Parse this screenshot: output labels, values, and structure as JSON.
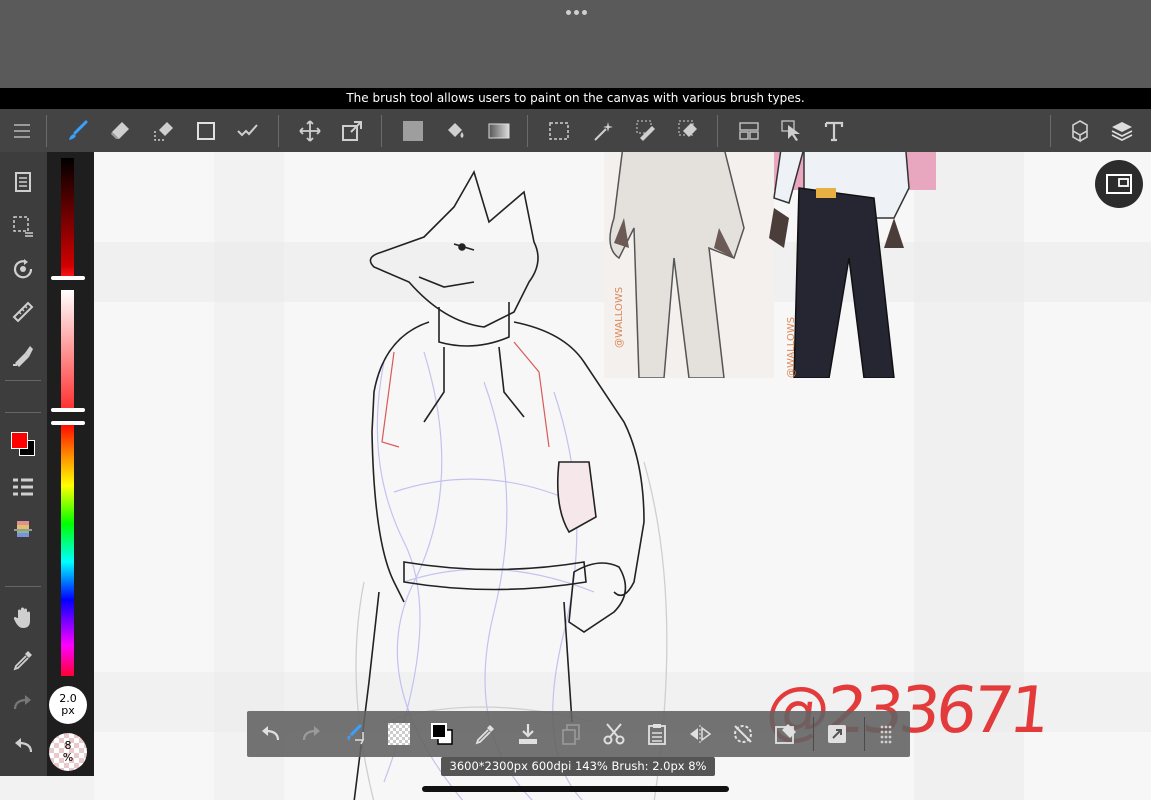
{
  "app": {
    "tooltip": "The brush tool allows users to paint on the canvas with various brush types."
  },
  "toolbar": {
    "items": [
      "menu",
      "brush",
      "eraser",
      "lasso-eraser",
      "shape",
      "correction",
      "move",
      "transform",
      "fill-color",
      "fill-bucket",
      "gradient",
      "selection",
      "magic-wand",
      "select-pen",
      "select-eraser",
      "divide-frame",
      "select-pointer",
      "text",
      "3d-model",
      "layers"
    ]
  },
  "sidebar": {
    "items": [
      "layer-properties",
      "selection-menu",
      "rotate-canvas",
      "ruler",
      "fill-tool",
      "brush-list",
      "color-palette",
      "hand",
      "eyedropper",
      "redo",
      "undo"
    ]
  },
  "color": {
    "primary": "#ff0000",
    "secondary": "#000000"
  },
  "brush_size": {
    "value": "2.0",
    "unit": "px"
  },
  "brush_opacity": {
    "value": "8",
    "unit": "%"
  },
  "canvas": {
    "signature": "@233671",
    "watermark": "@WALLOWS"
  },
  "bottom_toolbar": {
    "items": [
      "undo",
      "redo",
      "transform-brush",
      "transparent",
      "swap-colors",
      "eyedropper",
      "save",
      "copy",
      "cut",
      "paste",
      "flip",
      "rotate-reset",
      "clear",
      "snap",
      "drag-handle"
    ]
  },
  "status": {
    "text": "3600*2300px 600dpi 143% Brush: 2.0px 8%"
  }
}
